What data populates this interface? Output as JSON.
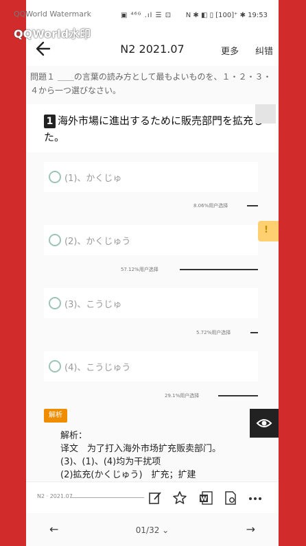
{
  "status_bar": {
    "watermark_small": "QQWorld Watermark",
    "watermark_large": "QQWorld水印",
    "icons_left": "▣ ⁴⁶ᴳ .ıl ☰ ⊡",
    "icons_right": "N ✱ ◧ ▯ [100]⁺ ✱ 19:53"
  },
  "header": {
    "title": "N2 2021.07",
    "more_label": "更多",
    "correct_label": "纠错"
  },
  "instruction": "問題１ ＿＿の言葉の読み方として最もよいものを、１・２・３・４から一つ選びなさい。",
  "question": {
    "number": "1",
    "text": "海外市場に進出するために販売部門を拡充した。"
  },
  "options": [
    {
      "label": "(1)、かくじゅ",
      "stat": "8.06%用户选择",
      "ratio": 0.0806
    },
    {
      "label": "(2)、かくじゅう",
      "stat": "57.12%用户选择",
      "ratio": 0.5712
    },
    {
      "label": "(3)、こうじゅ",
      "stat": "5.72%用户选择",
      "ratio": 0.0572
    },
    {
      "label": "(4)、こうじゅう",
      "stat": "29.1%用户选择",
      "ratio": 0.291
    }
  ],
  "side_button": "!",
  "analysis": {
    "tag": "解析",
    "heading": "解析：",
    "translation": "译文　为了打入海外市场扩充贩卖部门。",
    "line2": "(3)、(1)、(4)均为干扰项",
    "line3": "(2)拡充(かくじゅう)　扩充；扩建"
  },
  "toolbar": {
    "label": "N2 · 2021.07"
  },
  "pager": {
    "prev": "←",
    "page": "01/32 ⌄",
    "next": "→"
  },
  "colors": {
    "background": "#d22b2b",
    "radio": "#9cc4b4",
    "tag": "#f08c00",
    "side_button": "#ffd070"
  }
}
